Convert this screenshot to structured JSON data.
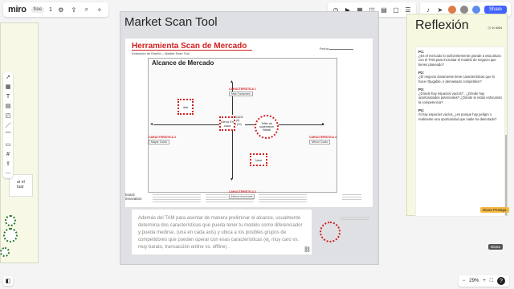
{
  "app": {
    "logo": "miro",
    "plan_badge": "free",
    "counter": "1"
  },
  "topbar_right": {
    "share_label": "Share",
    "avatars": [
      {
        "initials": "",
        "color": "#e07a4a"
      },
      {
        "initials": "",
        "color": "#8a8a8a"
      },
      {
        "initials": "",
        "color": "#5b8def"
      }
    ]
  },
  "left_frame": {
    "text_lines": [
      "ar el",
      "tuar"
    ]
  },
  "main_frame": {
    "title": "Market Scan Tool",
    "doc_title": "Herramienta Scan de Mercado",
    "doc_subtitle": "Extensión de Diseño – Market Scan Tool",
    "fecha_label": "Fecha:",
    "inner_title": "Alcance de Mercado",
    "chars": {
      "top": {
        "label": "CARACTERÍSTICA 1",
        "value": "Más Funciones"
      },
      "bottom": {
        "label": "CARACTERÍSTICA 2",
        "value": "Menos funciones"
      },
      "left": {
        "label": "CARACTERÍSTICA 3",
        "value": "Mayor Costo"
      },
      "right": {
        "label": "CARACTERÍSTICA 4",
        "value": "Menor Costo"
      }
    },
    "legend": [
      "= MERCADO",
      "= TAM (A)",
      "= CAM (Y2)"
    ],
    "boxes": {
      "dial": "dial",
      "en_casa": "Alexa En casa",
      "totter": "Totter de supervisión infantil",
      "nest": "Nest"
    },
    "footer_logo": [
      "board",
      "innovation"
    ]
  },
  "note": {
    "text": "Además del TAM para asentar de manera preliminar el alcance, usualmente determina dos características que pueda tener tu modelo como diferenciador y pueda medirse, (una en cada axis) y ubica a los posibles grupos de competidores que pueden operar con esas características (ej, muy caro  vs. muy barato, transacción online vs. offline) ."
  },
  "reflection": {
    "title": "Reflexión",
    "timer": "10 MIN",
    "questions": [
      {
        "label": "P1:",
        "text": "¿Es el mercado lo suficientemente grande a esta altura con el TAM para incrustar el modelo de negocio que tienes planeado?"
      },
      {
        "label": "P2:",
        "text": "¿El negocio claramente tiene características que lo hace rrtjugable, o demasiado competitivo?"
      },
      {
        "label": "P3:",
        "text": "¿Dónde hay espacios vacíos? , ¿Dónde hay oportunidades potenciales? ¿Dónde te estás enfocando la competencia?"
      },
      {
        "label": "P4:",
        "text": "Si hay espacios vacíos, ¿es porque hay peligro o realmente una oportunidad que nadie ha detectado?"
      }
    ],
    "cursor_tag": "Diana Pestaga"
  },
  "diana_tag": "Diana",
  "zoom": {
    "level": "29%"
  }
}
